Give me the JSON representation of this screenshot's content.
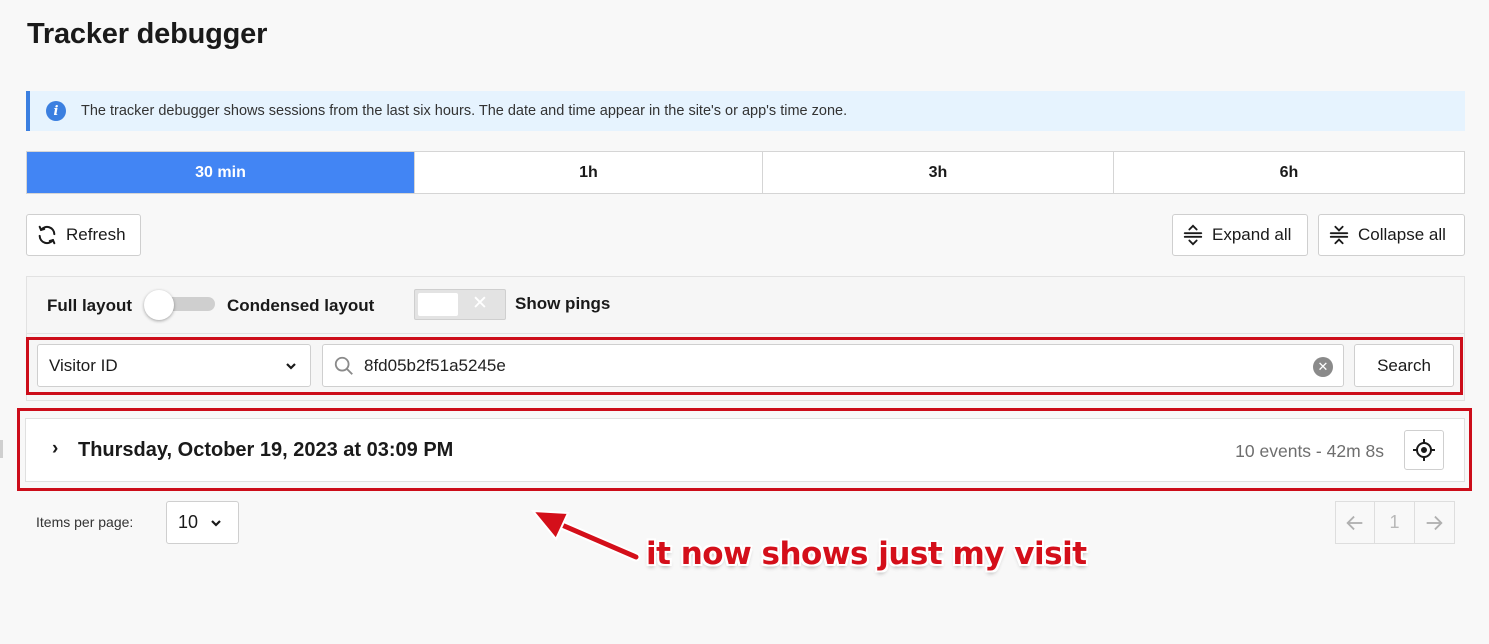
{
  "page": {
    "title": "Tracker debugger"
  },
  "info": {
    "icon": "info-icon",
    "text": "The tracker debugger shows sessions from the last six hours. The date and time appear in the site's or app's time zone."
  },
  "time_tabs": [
    {
      "label": "30 min",
      "active": true
    },
    {
      "label": "1h",
      "active": false
    },
    {
      "label": "3h",
      "active": false
    },
    {
      "label": "6h",
      "active": false
    }
  ],
  "toolbar": {
    "refresh_label": "Refresh",
    "expand_label": "Expand all",
    "collapse_label": "Collapse all"
  },
  "layout": {
    "full_label": "Full layout",
    "condensed_label": "Condensed layout",
    "condensed_on": false,
    "pings_label": "Show pings",
    "pings_on": false
  },
  "filter": {
    "field_selected": "Visitor ID",
    "search_value": "8fd05b2f51a5245e",
    "search_button": "Search"
  },
  "sessions": [
    {
      "date": "Thursday, October 19, 2023 at 03:09 PM",
      "meta": "10 events - 42m 8s"
    }
  ],
  "pagination": {
    "items_per_page_label": "Items per page:",
    "items_per_page": "10",
    "current_page": "1"
  },
  "annotation": {
    "text": "it now shows just my visit",
    "color": "#d40f1a"
  },
  "colors": {
    "accent": "#4285f4",
    "highlight": "#cc0d1a",
    "banner_bg": "#e6f3fe"
  }
}
